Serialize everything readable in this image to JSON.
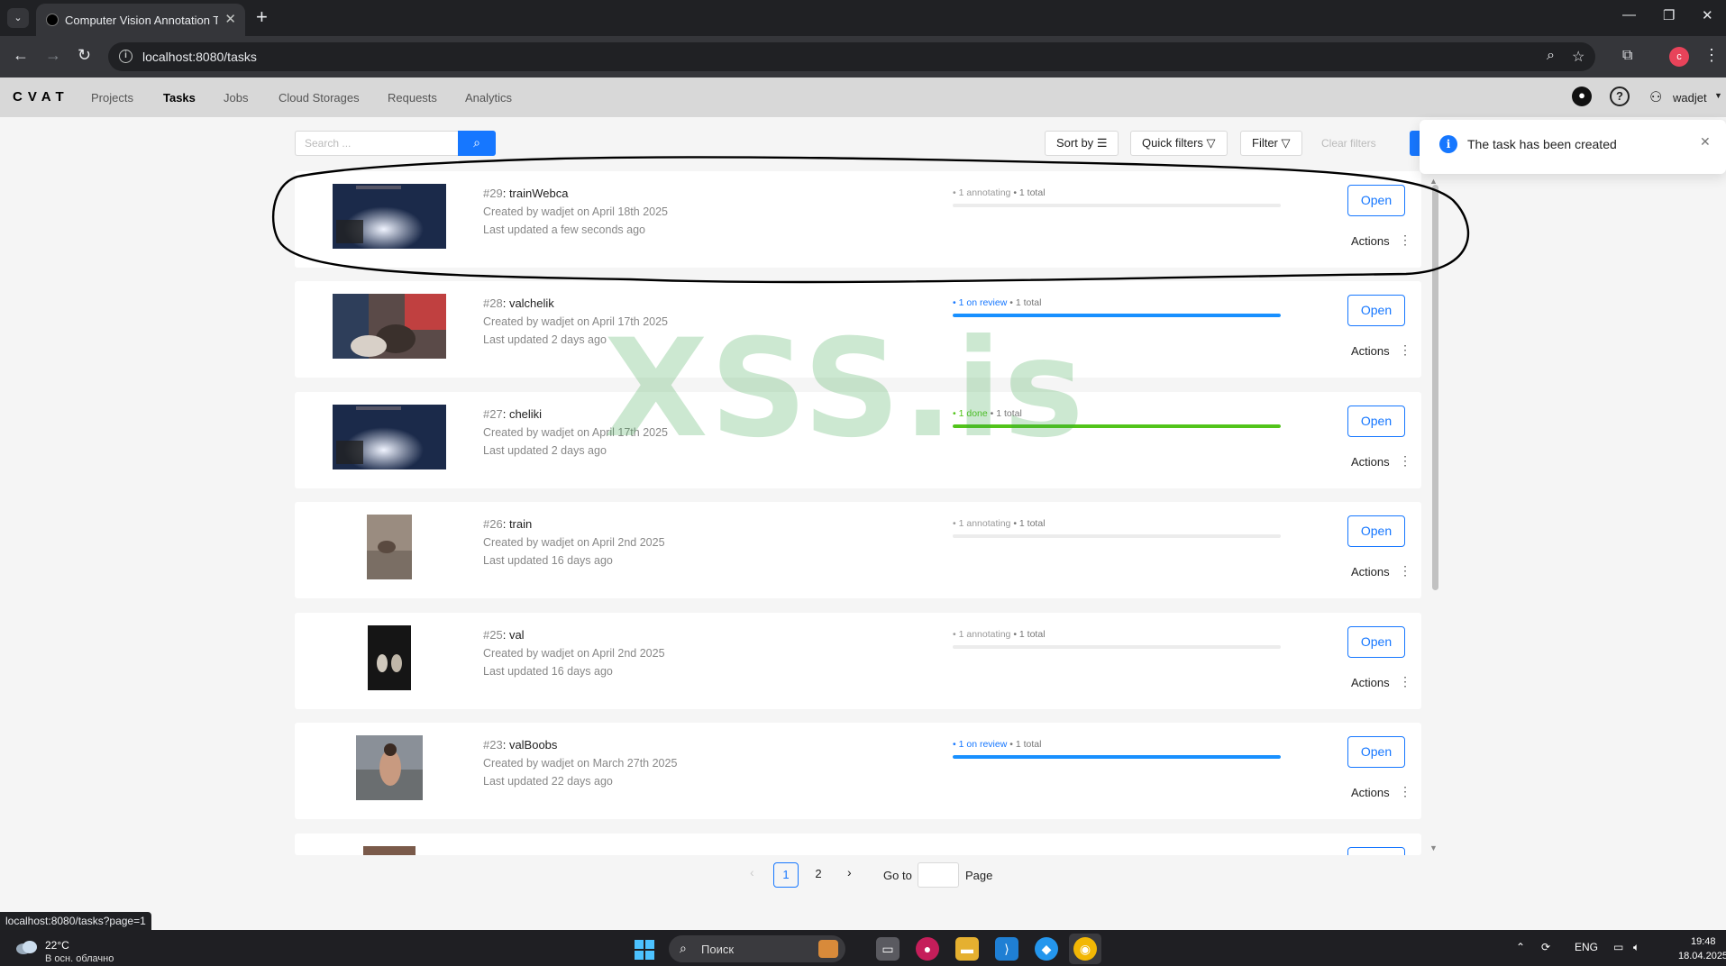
{
  "browser": {
    "tab_title": "Computer Vision Annotation Tool",
    "url": "localhost:8080/tasks",
    "profile_initial": "c"
  },
  "app": {
    "logo": "CVAT",
    "nav": [
      "Projects",
      "Tasks",
      "Jobs",
      "Cloud Storages",
      "Requests",
      "Analytics"
    ],
    "active_nav": "Tasks",
    "user": "wadjet"
  },
  "toolbar": {
    "search_placeholder": "Search ...",
    "sort_by": "Sort by",
    "quick_filters": "Quick filters",
    "filter": "Filter",
    "clear_filters": "Clear filters"
  },
  "tasks": [
    {
      "id": "#29",
      "name": "trainWebca",
      "created": "Created by wadjet on April 18th 2025",
      "updated": "Last updated a few seconds ago",
      "status": "1 annotating",
      "status_color": "#999999",
      "total": "1 total",
      "progress": 0,
      "bar_color": "#ececec"
    },
    {
      "id": "#28",
      "name": "valchelik",
      "created": "Created by wadjet on April 17th 2025",
      "updated": "Last updated 2 days ago",
      "status": "1 on review",
      "status_color": "#1677ff",
      "total": "1 total",
      "progress": 1,
      "bar_color": "#1890ff"
    },
    {
      "id": "#27",
      "name": "cheliki",
      "created": "Created by wadjet on April 17th 2025",
      "updated": "Last updated 2 days ago",
      "status": "1 done",
      "status_color": "#52c41a",
      "total": "1 total",
      "progress": 1,
      "bar_color": "#52c41a"
    },
    {
      "id": "#26",
      "name": "train",
      "created": "Created by wadjet on April 2nd 2025",
      "updated": "Last updated 16 days ago",
      "status": "1 annotating",
      "status_color": "#999999",
      "total": "1 total",
      "progress": 0,
      "bar_color": "#ececec"
    },
    {
      "id": "#25",
      "name": "val",
      "created": "Created by wadjet on April 2nd 2025",
      "updated": "Last updated 16 days ago",
      "status": "1 annotating",
      "status_color": "#999999",
      "total": "1 total",
      "progress": 0,
      "bar_color": "#ececec"
    },
    {
      "id": "#23",
      "name": "valBoobs",
      "created": "Created by wadjet on March 27th 2025",
      "updated": "Last updated 22 days ago",
      "status": "1 on review",
      "status_color": "#1677ff",
      "total": "1 total",
      "progress": 1,
      "bar_color": "#1890ff"
    }
  ],
  "task_actions": {
    "open": "Open",
    "actions": "Actions"
  },
  "pagination": {
    "pages": [
      "1",
      "2"
    ],
    "current": "1",
    "goto": "Go to",
    "page": "Page"
  },
  "watermark": "XSS.is",
  "status_url": "localhost:8080/tasks?page=1",
  "notification": {
    "message": "The task has been created"
  },
  "taskbar": {
    "temperature": "22°C",
    "weather": "В осн. облачно",
    "search": "Поиск",
    "lang": "ENG",
    "time": "19:48",
    "date": "18.04.2025"
  }
}
